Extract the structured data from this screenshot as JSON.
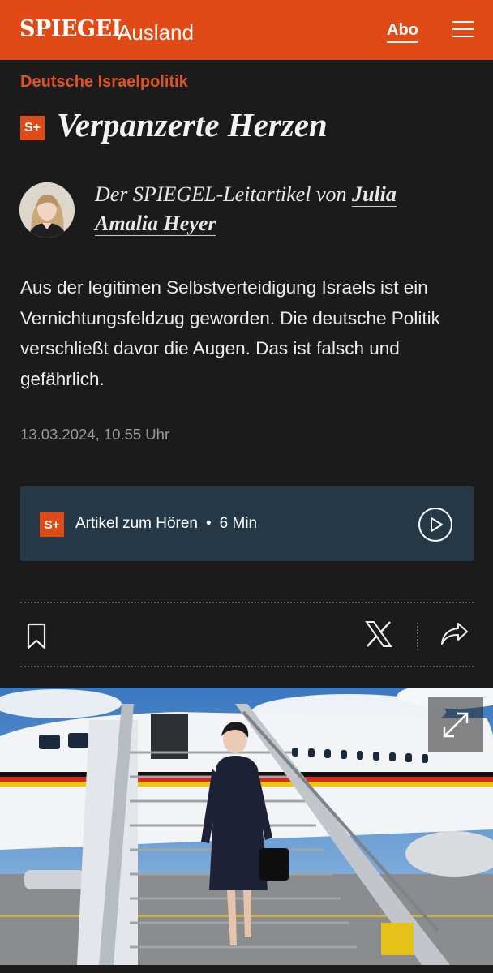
{
  "header": {
    "brand": "SPIEGEL",
    "section": "Ausland",
    "abo_label": "Abo",
    "menu_icon": "hamburger-menu-icon",
    "background_color": "#e04a17"
  },
  "article": {
    "kicker": "Deutsche Israelpolitik",
    "plus_badge": "S+",
    "headline": "Verpanzerte Herzen",
    "byline_prefix": "Der SPIEGEL-Leitartikel von",
    "author": "Julia Amalia Heyer",
    "teaser": "Aus der legitimen Selbstverteidigung Israels ist ein Vernichtungsfeldzug geworden. Die deutsche Politik verschließt davor die Augen. Das ist falsch und gefährlich.",
    "date": "13.03.2024, 10.55 Uhr"
  },
  "audio": {
    "badge": "S+",
    "label": "Artikel zum Hören",
    "separator": "•",
    "duration": "6 Min",
    "play_icon": "play-icon",
    "background_color": "#243847"
  },
  "actions": {
    "bookmark_icon": "bookmark-icon",
    "x_icon": "x-share-icon",
    "share_icon": "share-arrow-icon"
  },
  "image": {
    "expand_icon": "expand-icon"
  },
  "colors": {
    "accent": "#e04a17",
    "kicker": "#e2521f",
    "background": "#1b1b1b"
  }
}
